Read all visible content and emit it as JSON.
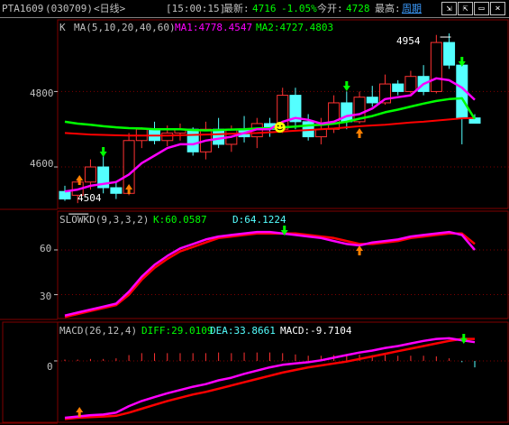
{
  "header": {
    "symbol": "PTA1609",
    "code": "(030709)",
    "period": "<日线>",
    "time": "[15:00:15]",
    "latest_label": "最新:",
    "latest_value": "4716",
    "change_pct": "-1.05%",
    "open_label": "今开:",
    "open_value": "4728",
    "high_label": "最高:",
    "period_link": "周期"
  },
  "colors": {
    "up": "#ff3232",
    "down": "#54ffff",
    "grid": "#800000",
    "ma1": "#ff00ff",
    "ma2": "#00ff00",
    "ma3": "#ff0000",
    "k_line": "#ff00ff",
    "d_line": "#ff0000",
    "diff_line": "#ff00ff",
    "dea_line": "#ff0000",
    "text_green": "#00ff00",
    "text_cyan": "#54ffff",
    "text_white": "#ffffff"
  },
  "price_panel": {
    "title": "K",
    "ma_label": "MA(5,10,20,40,60)",
    "ma1_label": "MA1:4778.4547",
    "ma2_label": "MA2:4727.4803",
    "axis_labels": [
      "4800",
      "4600"
    ],
    "max_label": "4954",
    "min_label": "4504"
  },
  "kd_panel": {
    "title": "SLOWKD(9,3,3,2)",
    "k_label": "K:60.0587",
    "d_label": "D:64.1224",
    "axis_labels": [
      "60",
      "30"
    ]
  },
  "macd_panel": {
    "title": "MACD(26,12,4)",
    "diff_label": "DIFF:29.0109",
    "dea_label": "DEA:33.8661",
    "macd_label": "MACD:-9.7104",
    "axis_labels": [
      "0"
    ]
  },
  "chart_data": [
    {
      "type": "candlestick",
      "title": "K",
      "ylim": [
        4490,
        4990
      ],
      "yticks": [
        4600,
        4800
      ],
      "candles": [
        {
          "o": 4535,
          "h": 4550,
          "l": 4510,
          "c": 4515
        },
        {
          "o": 4525,
          "h": 4570,
          "l": 4504,
          "c": 4560
        },
        {
          "o": 4560,
          "h": 4620,
          "l": 4540,
          "c": 4600
        },
        {
          "o": 4600,
          "h": 4640,
          "l": 4530,
          "c": 4545
        },
        {
          "o": 4545,
          "h": 4560,
          "l": 4515,
          "c": 4530
        },
        {
          "o": 4530,
          "h": 4690,
          "l": 4525,
          "c": 4670
        },
        {
          "o": 4670,
          "h": 4705,
          "l": 4650,
          "c": 4700
        },
        {
          "o": 4700,
          "h": 4720,
          "l": 4660,
          "c": 4670
        },
        {
          "o": 4670,
          "h": 4710,
          "l": 4655,
          "c": 4690
        },
        {
          "o": 4690,
          "h": 4715,
          "l": 4670,
          "c": 4700
        },
        {
          "o": 4700,
          "h": 4705,
          "l": 4630,
          "c": 4640
        },
        {
          "o": 4640,
          "h": 4720,
          "l": 4620,
          "c": 4700
        },
        {
          "o": 4700,
          "h": 4730,
          "l": 4650,
          "c": 4660
        },
        {
          "o": 4660,
          "h": 4710,
          "l": 4640,
          "c": 4700
        },
        {
          "o": 4700,
          "h": 4735,
          "l": 4665,
          "c": 4680
        },
        {
          "o": 4680,
          "h": 4730,
          "l": 4650,
          "c": 4715
        },
        {
          "o": 4715,
          "h": 4730,
          "l": 4680,
          "c": 4700
        },
        {
          "o": 4700,
          "h": 4810,
          "l": 4690,
          "c": 4790
        },
        {
          "o": 4790,
          "h": 4810,
          "l": 4700,
          "c": 4720
        },
        {
          "o": 4720,
          "h": 4740,
          "l": 4670,
          "c": 4680
        },
        {
          "o": 4680,
          "h": 4730,
          "l": 4660,
          "c": 4700
        },
        {
          "o": 4700,
          "h": 4790,
          "l": 4690,
          "c": 4770
        },
        {
          "o": 4770,
          "h": 4800,
          "l": 4700,
          "c": 4720
        },
        {
          "o": 4720,
          "h": 4800,
          "l": 4715,
          "c": 4785
        },
        {
          "o": 4785,
          "h": 4815,
          "l": 4760,
          "c": 4770
        },
        {
          "o": 4770,
          "h": 4845,
          "l": 4765,
          "c": 4820
        },
        {
          "o": 4820,
          "h": 4830,
          "l": 4790,
          "c": 4800
        },
        {
          "o": 4800,
          "h": 4855,
          "l": 4795,
          "c": 4840
        },
        {
          "o": 4840,
          "h": 4870,
          "l": 4790,
          "c": 4800
        },
        {
          "o": 4800,
          "h": 4950,
          "l": 4795,
          "c": 4930
        },
        {
          "o": 4930,
          "h": 4954,
          "l": 4860,
          "c": 4870
        },
        {
          "o": 4870,
          "h": 4880,
          "l": 4660,
          "c": 4730
        },
        {
          "o": 4730,
          "h": 4740,
          "l": 4715,
          "c": 4716
        }
      ],
      "ma1": [
        4535,
        4540,
        4550,
        4555,
        4560,
        4580,
        4610,
        4630,
        4650,
        4660,
        4660,
        4670,
        4675,
        4680,
        4690,
        4700,
        4700,
        4720,
        4730,
        4725,
        4715,
        4720,
        4735,
        4740,
        4755,
        4780,
        4785,
        4790,
        4820,
        4835,
        4830,
        4810,
        4778
      ],
      "ma2": [
        4720,
        4715,
        4712,
        4708,
        4705,
        4703,
        4702,
        4700,
        4700,
        4700,
        4698,
        4697,
        4698,
        4699,
        4700,
        4702,
        4703,
        4705,
        4707,
        4710,
        4712,
        4715,
        4720,
        4728,
        4735,
        4745,
        4752,
        4760,
        4768,
        4775,
        4780,
        4782,
        4727
      ],
      "ma3": [
        4690,
        4688,
        4686,
        4685,
        4684,
        4683,
        4683,
        4683,
        4683,
        4684,
        4685,
        4686,
        4687,
        4688,
        4689,
        4690,
        4692,
        4694,
        4696,
        4698,
        4700,
        4702,
        4705,
        4708,
        4710,
        4712,
        4715,
        4718,
        4720,
        4723,
        4726,
        4729,
        4730
      ]
    },
    {
      "type": "line",
      "title": "SLOWKD(9,3,3,2)",
      "ylim": [
        14,
        86
      ],
      "yticks": [
        30,
        60
      ],
      "series": [
        {
          "name": "K",
          "values": [
            16,
            18,
            20,
            22,
            24,
            32,
            42,
            50,
            56,
            61,
            64,
            67,
            69,
            70,
            71,
            72,
            72,
            71,
            70,
            69,
            68,
            66,
            64,
            63,
            65,
            66,
            67,
            69,
            70,
            71,
            72,
            70,
            60
          ]
        },
        {
          "name": "D",
          "values": [
            15,
            17,
            19,
            21,
            23,
            30,
            40,
            48,
            54,
            59,
            62,
            65,
            68,
            69,
            70,
            71,
            71,
            71,
            71,
            70,
            69,
            68,
            66,
            64,
            64,
            65,
            66,
            68,
            69,
            70,
            71,
            71,
            64
          ]
        }
      ]
    },
    {
      "type": "line",
      "title": "MACD(26,12,4)",
      "ylim": [
        -95,
        60
      ],
      "yticks": [
        0
      ],
      "series": [
        {
          "name": "DIFF",
          "values": [
            -88,
            -86,
            -84,
            -83,
            -80,
            -70,
            -62,
            -56,
            -50,
            -45,
            -40,
            -36,
            -30,
            -26,
            -20,
            -15,
            -10,
            -6,
            -4,
            -2,
            1,
            5,
            9,
            13,
            16,
            20,
            23,
            27,
            31,
            34,
            35,
            32,
            29
          ]
        },
        {
          "name": "DEA",
          "values": [
            -90,
            -88,
            -87,
            -86,
            -85,
            -80,
            -74,
            -68,
            -62,
            -57,
            -52,
            -48,
            -43,
            -38,
            -33,
            -28,
            -23,
            -18,
            -14,
            -10,
            -7,
            -4,
            -1,
            3,
            7,
            11,
            15,
            19,
            23,
            27,
            31,
            34,
            34
          ]
        },
        {
          "name": "MACD",
          "values": [
            2,
            2,
            3,
            3,
            4,
            9,
            12,
            12,
            12,
            12,
            12,
            12,
            13,
            12,
            13,
            13,
            13,
            12,
            10,
            8,
            8,
            9,
            10,
            10,
            9,
            9,
            8,
            8,
            8,
            7,
            4,
            -2,
            -10
          ]
        }
      ]
    }
  ]
}
